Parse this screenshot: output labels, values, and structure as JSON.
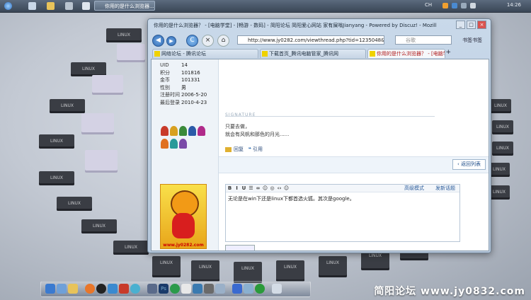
{
  "topbar": {
    "task_label": "你用的是什么浏览器...",
    "tray_lang": "CH",
    "clock": "14:26"
  },
  "desktop": {
    "chip_label": "LINUX"
  },
  "window": {
    "title": "你用的是什么浏览器？ - [电脑学堂] - [畅游 - 数码] - 简阳论坛 简阳爱心网站 家有屎嗡Jianyang - Powered by Discuz! - Mozilla...",
    "btn_min": "_",
    "btn_max": "□",
    "btn_close": "×"
  },
  "nav": {
    "back": "◀",
    "forward": "▶",
    "reload": "C",
    "home": "⌂",
    "url": "http://www.jy0282.com/viewthread.php?tid=1235048&",
    "search_placeholder": "谷歌",
    "bookmarks": "书签书签"
  },
  "tabs": [
    {
      "label": "网络论坛 - 腾讯论坛"
    },
    {
      "label": "下载首页_腾讯电脑管家_腾讯网"
    },
    {
      "label": "你用的是什么浏览器？ - [电脑学..."
    }
  ],
  "new_tab": "+",
  "profile": {
    "fields": [
      {
        "key": "UID",
        "value": "14"
      },
      {
        "key": "积分",
        "value": "101816"
      },
      {
        "key": "金币",
        "value": "101331"
      },
      {
        "key": "性别",
        "value": "男"
      },
      {
        "key": "注册时间",
        "value": "2006-5-20"
      },
      {
        "key": "最后登录",
        "value": "2010-4-23"
      }
    ],
    "medal_colors": [
      "#c83a2a",
      "#d8a020",
      "#3a8a3a",
      "#2a5aa8",
      "#b02a8a",
      "#e07020",
      "#2a9a9a",
      "#7a4aa8"
    ]
  },
  "post": {
    "signature_label": "SIGNATURE",
    "lines": [
      "只要去做，",
      "就会有风帆和那色的月光......"
    ],
    "reply": "回复",
    "quote": "引用",
    "back_to_list": "‹ 返回列表"
  },
  "avatar": {
    "site": "www.jy0282.com"
  },
  "editor": {
    "toolbar": [
      "B",
      "I",
      "U",
      "☰",
      "∞",
      "☺",
      "◎",
      "‹›",
      "☺"
    ],
    "advanced": "高级模式",
    "new_topic": "发新话题",
    "text": "无论是在win下还是linux下都首选火狐。其次是google。"
  },
  "footer": "简阳论坛 www.jy0832.com"
}
